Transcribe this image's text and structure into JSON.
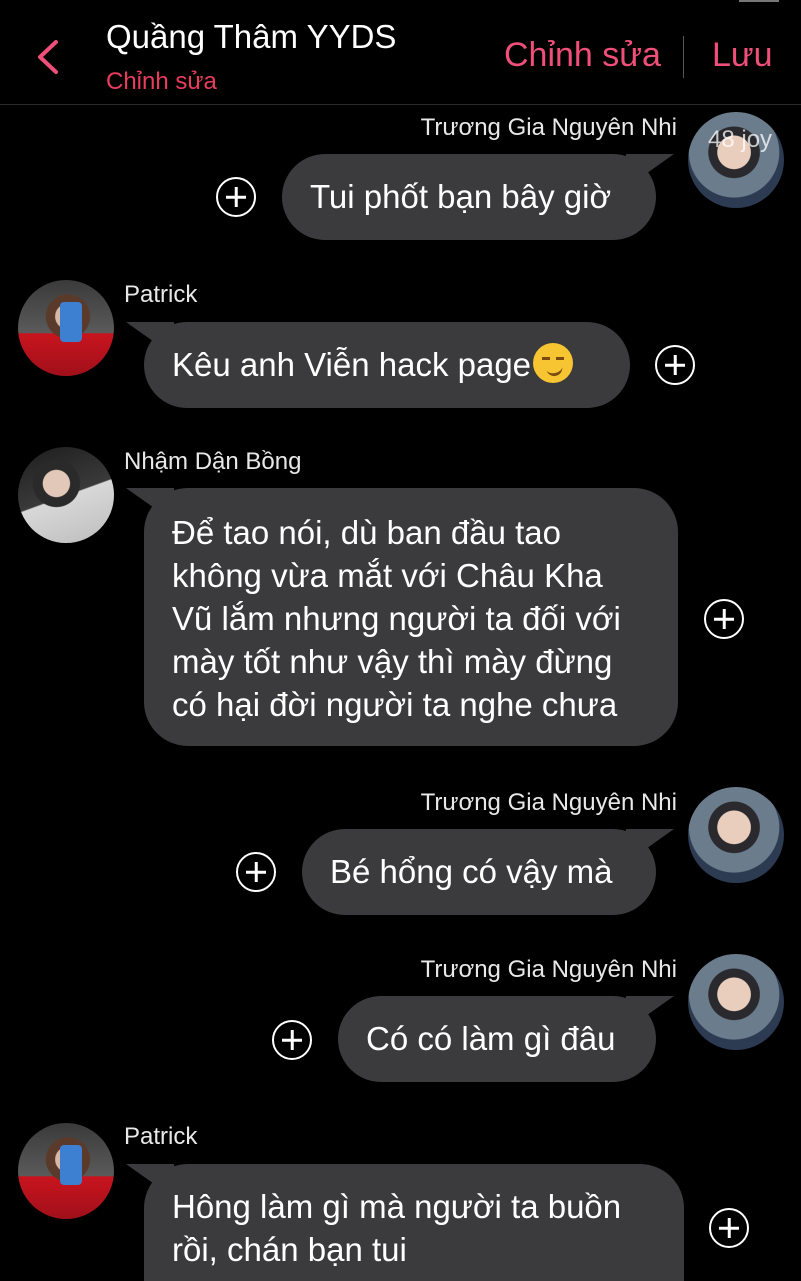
{
  "header": {
    "title": "Quầng Thâm YYDS",
    "subtitle": "Chỉnh sửa",
    "edit_label": "Chỉnh sửa",
    "save_label": "Lưu"
  },
  "messages": [
    {
      "sender": "Trương Gia Nguyên Nhi",
      "side": "right",
      "lines": [
        "Tui phốt bạn bây giờ"
      ],
      "avatar_watermark": "48 joy"
    },
    {
      "sender": "Patrick",
      "side": "left",
      "lines": [
        "Kêu anh Viễn hack page"
      ],
      "emoji": "smirking-face-icon"
    },
    {
      "sender": "Nhậm Dận Bồng",
      "side": "left",
      "lines": [
        "Để tao nói, dù ban đầu tao",
        "không vừa mắt với Châu Kha",
        "Vũ lắm nhưng người ta đối với",
        "mày tốt như vậy thì mày đừng",
        "có hại đời người ta nghe chưa"
      ]
    },
    {
      "sender": "Trương Gia Nguyên Nhi",
      "side": "right",
      "lines": [
        "Bé hổng có vậy mà"
      ]
    },
    {
      "sender": "Trương Gia Nguyên Nhi",
      "side": "right",
      "lines": [
        "Có có làm gì đâu"
      ]
    },
    {
      "sender": "Patrick",
      "side": "left",
      "lines": [
        "Hông làm gì mà người ta buồn",
        "rồi, chán bạn tui"
      ]
    }
  ],
  "colors": {
    "accent": "#ef4f78",
    "bubble": "#3b3b3d",
    "background": "#000000"
  }
}
